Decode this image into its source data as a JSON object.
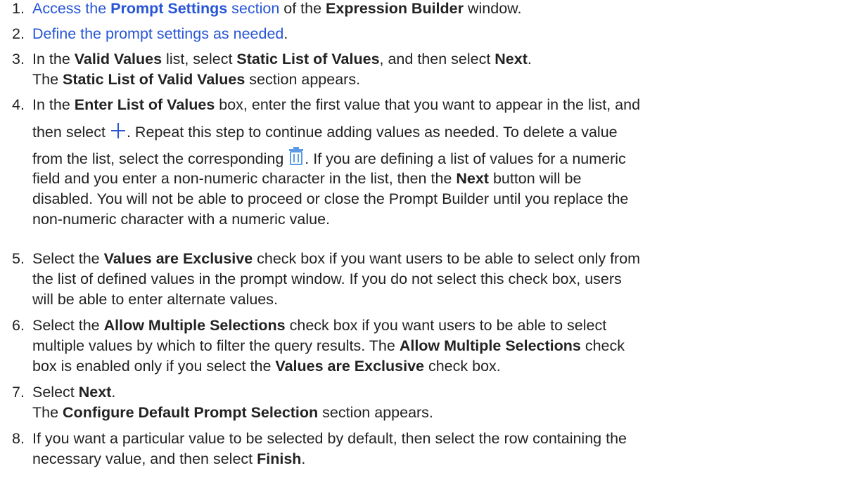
{
  "steps": [
    {
      "number": "1.",
      "link_pre": "Access the ",
      "link_bold": "Prompt Settings",
      "link_post": " section",
      "text_a": " of the ",
      "bold_a": "Expression Builder",
      "text_b": " window."
    },
    {
      "number": "2.",
      "link": "Define the prompt settings as needed",
      "text_a": "."
    },
    {
      "number": "3.",
      "text_a": "In the ",
      "bold_a": "Valid Values",
      "text_b": " list, select ",
      "bold_b": "Static List of Values",
      "text_c": ", and then select ",
      "bold_c": "Next",
      "text_d": ".",
      "line2_text_a": "The ",
      "line2_bold_a": "Static List of Valid Values",
      "line2_text_b": " section appears."
    },
    {
      "number": "4.",
      "l1_text_a": "In the ",
      "l1_bold_a": "Enter List of Values",
      "l1_text_b": " box, enter the first value that you want to appear in the list, and",
      "l2_text_a": "then select ",
      "l2_text_b": ". Repeat this step to continue adding values as needed. To delete a value",
      "l3_text_a": "from the list, select the corresponding ",
      "l3_text_b": ". If you are defining a list of values for a numeric",
      "l4_text_a": "field and you enter a non-numeric character in the list, then the ",
      "l4_bold_a": "Next",
      "l4_text_b": " button will be",
      "l5": "disabled. You will not be able to proceed or close the Prompt Builder until you replace the",
      "l6": "non-numeric character with a numeric value.",
      "icons": [
        "plus-icon",
        "trash-icon"
      ],
      "icon_color": "#2755d6"
    },
    {
      "number": "5.",
      "l1_text_a": "Select the ",
      "l1_bold_a": "Values are Exclusive",
      "l1_text_b": " check box if you want users to be able to select only from",
      "l2": "the list of defined values in the prompt window. If you do not select this check box, users",
      "l3": "will be able to enter alternate values."
    },
    {
      "number": "6.",
      "l1_text_a": "Select the ",
      "l1_bold_a": "Allow Multiple Selections",
      "l1_text_b": " check box if you want users to be able to select",
      "l2_text_a": "multiple values by which to filter the query results. The ",
      "l2_bold_a": "Allow Multiple Selections",
      "l2_text_b": " check",
      "l3_text_a": "box is enabled only if you select the ",
      "l3_bold_a": "Values are Exclusive",
      "l3_text_b": " check box."
    },
    {
      "number": "7.",
      "l1_text_a": "Select ",
      "l1_bold_a": "Next",
      "l1_text_b": ".",
      "l2_text_a": "The ",
      "l2_bold_a": "Configure Default Prompt Selection",
      "l2_text_b": " section appears."
    },
    {
      "number": "8.",
      "l1": "If you want a particular value to be selected by default, then select the row containing the",
      "l2_text_a": "necessary value, and then select ",
      "l2_bold_a": "Finish",
      "l2_text_b": "."
    }
  ],
  "colors": {
    "link": "#2755d6",
    "text": "#222222",
    "background": "#ffffff"
  }
}
